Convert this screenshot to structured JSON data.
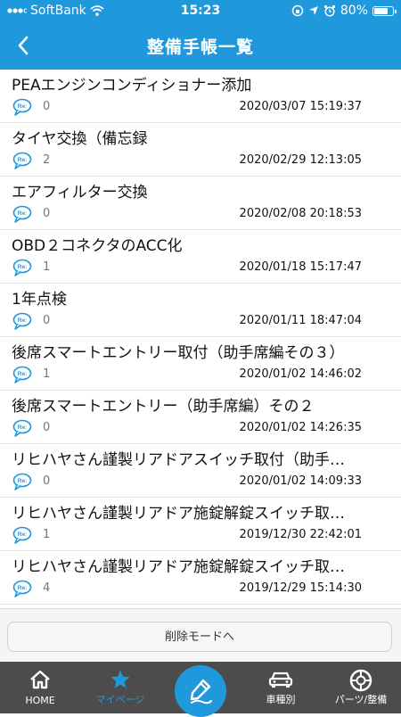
{
  "status": {
    "carrier": "SoftBank",
    "time": "15:23",
    "battery": "80%",
    "battery_level": 0.8
  },
  "header": {
    "title": "整備手帳一覧",
    "back_icon": "chevron-left-icon"
  },
  "items": [
    {
      "title": "PEAエンジンコンディショナー添加",
      "count": "0",
      "date": "2020/03/07 15:19:37"
    },
    {
      "title": "タイヤ交換（備忘録",
      "count": "2",
      "date": "2020/02/29 12:13:05"
    },
    {
      "title": "エアフィルター交換",
      "count": "0",
      "date": "2020/02/08 20:18:53"
    },
    {
      "title": "OBD２コネクタのACC化",
      "count": "1",
      "date": "2020/01/18 15:17:47"
    },
    {
      "title": "1年点検",
      "count": "0",
      "date": "2020/01/11 18:47:04"
    },
    {
      "title": "後席スマートエントリー取付（助手席編その３）",
      "count": "1",
      "date": "2020/01/02 14:46:02"
    },
    {
      "title": "後席スマートエントリー（助手席編）その２",
      "count": "0",
      "date": "2020/01/02 14:26:35"
    },
    {
      "title": "リヒハヤさん謹製リアドアスイッチ取付（助手…",
      "count": "0",
      "date": "2020/01/02 14:09:33"
    },
    {
      "title": "リヒハヤさん謹製リアドア施錠解錠スイッチ取…",
      "count": "1",
      "date": "2019/12/30 22:42:01"
    },
    {
      "title": "リヒハヤさん謹製リアドア施錠解錠スイッチ取…",
      "count": "4",
      "date": "2019/12/29 15:14:30"
    }
  ],
  "comment_icon_text": "Re:",
  "footer": {
    "delete_mode": "削除モードへ"
  },
  "tabs": [
    {
      "label": "HOME",
      "icon": "home-icon"
    },
    {
      "label": "マイページ",
      "icon": "star-icon",
      "active": true
    },
    {
      "label": "",
      "icon": "pen-icon"
    },
    {
      "label": "車種別",
      "icon": "car-icon"
    },
    {
      "label": "パーツ/整備",
      "icon": "tire-icon"
    }
  ],
  "colors": {
    "accent": "#1f98dc",
    "tabbar": "#4c4c4c"
  }
}
